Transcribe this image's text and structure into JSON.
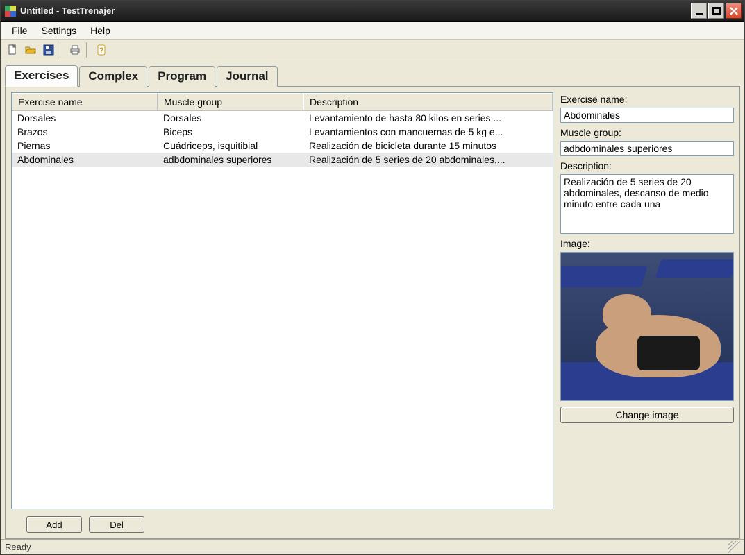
{
  "window": {
    "title": "Untitled - TestTrenajer"
  },
  "menu": {
    "file": "File",
    "settings": "Settings",
    "help": "Help"
  },
  "toolbar": {
    "new": "new-file-icon",
    "open": "open-folder-icon",
    "save": "save-icon",
    "print": "print-icon",
    "help": "help-icon"
  },
  "tabs": {
    "exercises": "Exercises",
    "complex": "Complex",
    "program": "Program",
    "journal": "Journal"
  },
  "columns": {
    "name": "Exercise name",
    "muscle": "Muscle group",
    "desc": "Description"
  },
  "rows": [
    {
      "name": "Dorsales",
      "muscle": "Dorsales",
      "desc": "Levantamiento de hasta 80 kilos en series ..."
    },
    {
      "name": "Brazos",
      "muscle": "Biceps",
      "desc": "Levantamientos con mancuernas de 5 kg e..."
    },
    {
      "name": "Piernas",
      "muscle": "Cuádriceps, isquitibial",
      "desc": "Realización de bicicleta durante 15 minutos"
    },
    {
      "name": "Abdominales",
      "muscle": "adbdominales superiores",
      "desc": "Realización de 5 series de 20 abdominales,..."
    }
  ],
  "selected_index": 3,
  "buttons": {
    "add": "Add",
    "del": "Del",
    "change_image": "Change image"
  },
  "panel": {
    "name_label": "Exercise name:",
    "name_value": "Abdominales",
    "muscle_label": "Muscle group:",
    "muscle_value": "adbdominales superiores",
    "desc_label": "Description:",
    "desc_value": "Realización de 5 series de 20 abdominales, descanso de medio minuto entre cada una",
    "image_label": "Image:"
  },
  "status": {
    "text": "Ready"
  }
}
